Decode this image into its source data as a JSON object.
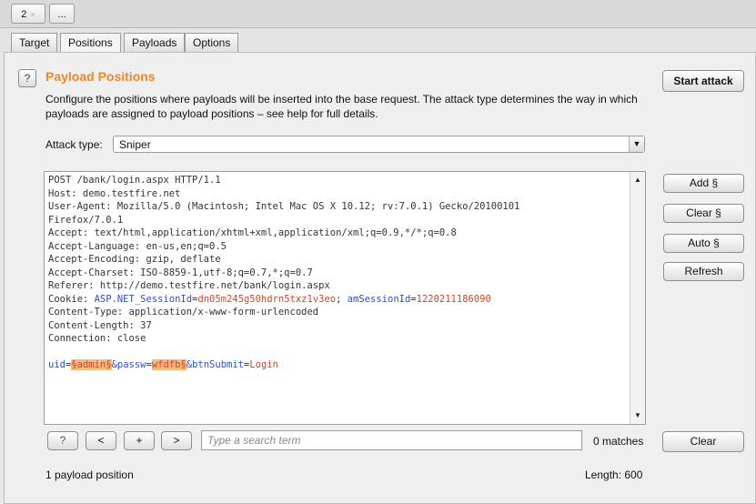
{
  "top_tabs": [
    {
      "label": "2",
      "close": "×"
    },
    {
      "label": "..."
    }
  ],
  "sub_tabs": [
    {
      "label": "Target"
    },
    {
      "label": "Positions"
    },
    {
      "label": "Payloads"
    },
    {
      "label": "Options"
    }
  ],
  "help_label": "?",
  "title": "Payload Positions",
  "description": "Configure the positions where payloads will be inserted into the base request. The attack type determines the way in which payloads are assigned to payload positions – see help for full details.",
  "start_attack_label": "Start attack",
  "attack_type": {
    "label": "Attack type:",
    "value": "Sniper"
  },
  "request": {
    "lines": [
      "POST /bank/login.aspx HTTP/1.1",
      "Host: demo.testfire.net",
      "User-Agent: Mozilla/5.0 (Macintosh; Intel Mac OS X 10.12; rv:7.0.1) Gecko/20100101",
      "Firefox/7.0.1",
      "Accept: text/html,application/xhtml+xml,application/xml;q=0.9,*/*;q=0.8",
      "Accept-Language: en-us,en;q=0.5",
      "Accept-Encoding: gzip, deflate",
      "Accept-Charset: ISO-8859-1,utf-8;q=0.7,*;q=0.7",
      "Referer: http://demo.testfire.net/bank/login.aspx"
    ],
    "cookie_prefix": "Cookie: ",
    "cookie_name1": "ASP.NET_SessionId",
    "cookie_val1": "dn05m245g50hdrn5txz1v3eo",
    "cookie_sep": "; ",
    "cookie_name2": "amSessionId",
    "cookie_val2": "1220211186090",
    "lines_after": [
      "Content-Type: application/x-www-form-urlencoded",
      "Content-Length: 37",
      "Connection: close"
    ],
    "body": {
      "p1_name": "uid",
      "p1_marked": "§admin§",
      "p2_name": "&passw",
      "p2_marked": "wfdfb§",
      "p3_name": "&btnSubmit",
      "p3_val": "Login"
    }
  },
  "side_buttons": [
    {
      "label": "Add §"
    },
    {
      "label": "Clear §"
    },
    {
      "label": "Auto §"
    },
    {
      "label": "Refresh"
    }
  ],
  "search_bar": {
    "help": "?",
    "prev": "<",
    "add": "+",
    "next": ">",
    "placeholder": "Type a search term",
    "matches": "0 matches",
    "clear": "Clear"
  },
  "footer": {
    "positions": "1 payload position",
    "length": "Length: 600"
  }
}
